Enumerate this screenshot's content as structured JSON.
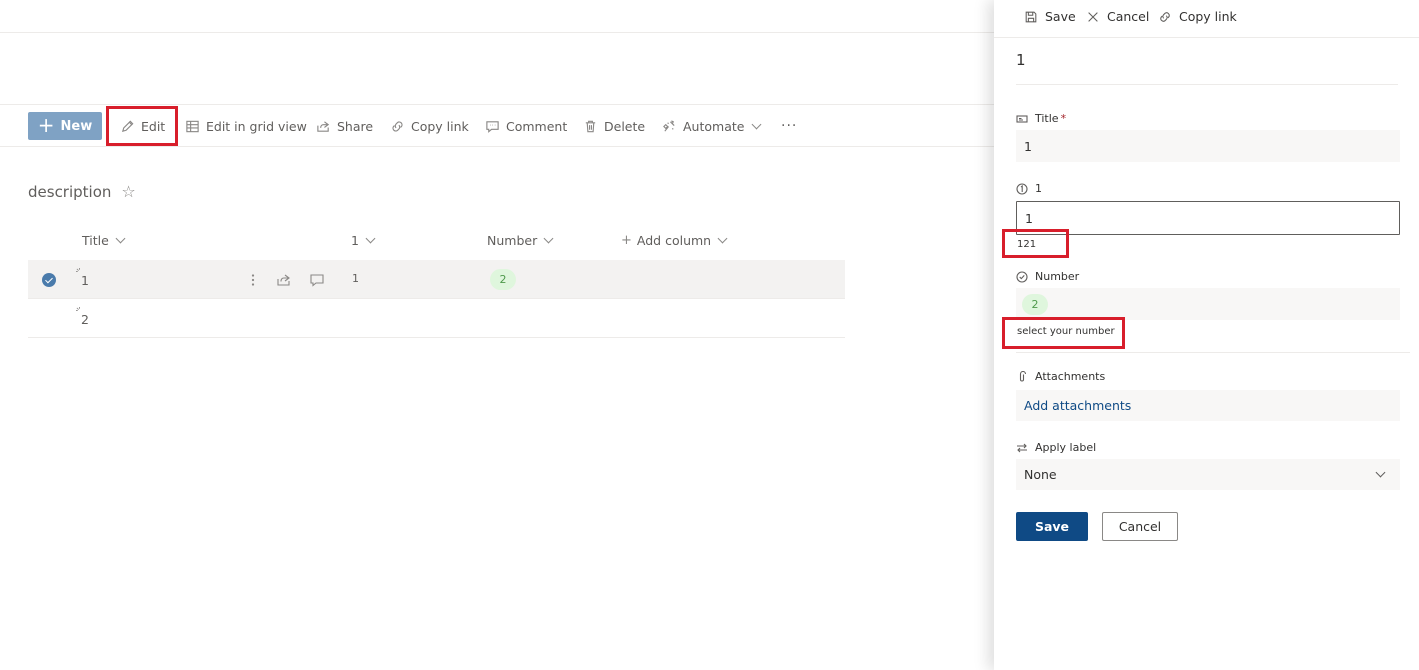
{
  "commandbar": {
    "new_label": "New",
    "edit_label": "Edit",
    "grid_label": "Edit in grid view",
    "share_label": "Share",
    "copylink_label": "Copy link",
    "comment_label": "Comment",
    "delete_label": "Delete",
    "automate_label": "Automate",
    "more_label": "···"
  },
  "list": {
    "title": "description",
    "columns": {
      "title": "Title",
      "col1": "1",
      "number": "Number",
      "add": "Add column"
    },
    "rows": [
      {
        "title": "1",
        "col1": "1",
        "number": "2"
      },
      {
        "title": "2",
        "col1": "",
        "number": ""
      }
    ]
  },
  "panel": {
    "toolbar": {
      "save": "Save",
      "cancel": "Cancel",
      "copylink": "Copy link"
    },
    "item_title": "1",
    "fields": {
      "title": {
        "label": "Title",
        "required_mark": "*",
        "value": "1"
      },
      "one": {
        "label": "1",
        "value": "1",
        "hint": "121"
      },
      "number": {
        "label": "Number",
        "value": "2",
        "hint": "select your number"
      },
      "attachments": {
        "label": "Attachments",
        "link": "Add attachments"
      },
      "apply_label": {
        "label": "Apply label",
        "value": "None"
      }
    },
    "buttons": {
      "save": "Save",
      "cancel": "Cancel"
    }
  },
  "colors": {
    "primary": "#0f4a85",
    "new_button": "#7fa2c4",
    "highlight_box": "#d81e2b",
    "number_pill_bg": "#dff6dd",
    "number_pill_text": "#4f9a4c"
  }
}
